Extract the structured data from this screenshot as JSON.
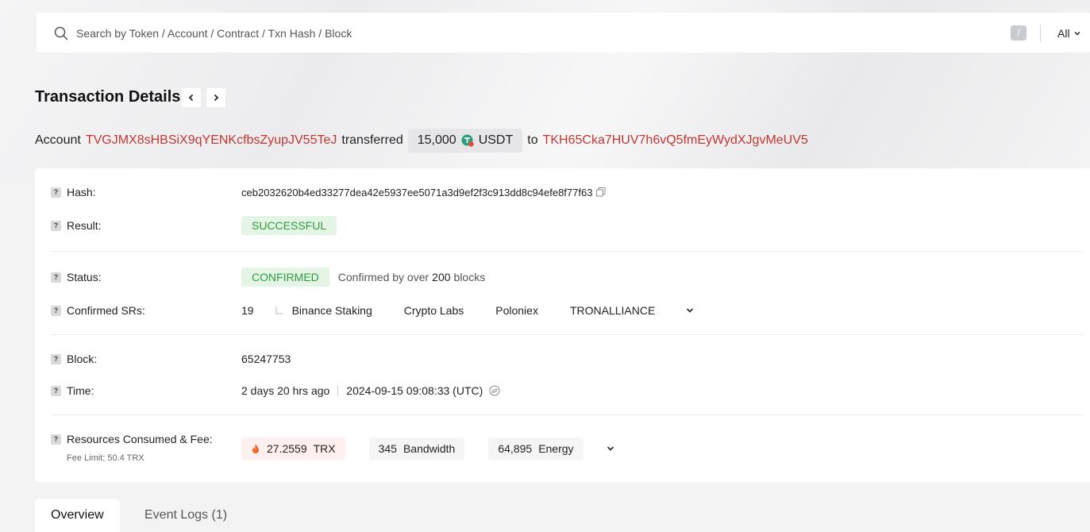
{
  "search": {
    "placeholder": "Search by Token / Account / Contract / Txn Hash / Block",
    "shortcut_key": "/",
    "scope": "All"
  },
  "page": {
    "title": "Transaction Details"
  },
  "summary": {
    "prefix": "Account",
    "from_address": "TVGJMX8sHBSiX9qYENKcfbsZyupJV55TeJ",
    "verb": "transferred",
    "amount": "15,000",
    "token": "USDT",
    "to_word": "to",
    "to_address": "TKH65Cka7HUV7h6vQ5fmEyWydXJgvMeUV5"
  },
  "details": {
    "hash": {
      "label": "Hash:",
      "value": "ceb2032620b4ed33277dea42e5937ee5071a3d9ef2f3c913dd8c94efe8f77f63"
    },
    "result": {
      "label": "Result:",
      "value": "SUCCESSFUL"
    },
    "status": {
      "label": "Status:",
      "value": "CONFIRMED",
      "note_prefix": "Confirmed by over",
      "note_count": "200",
      "note_suffix": "blocks"
    },
    "confirmed_srs": {
      "label": "Confirmed SRs:",
      "count": "19",
      "items": [
        "Binance Staking",
        "Crypto Labs",
        "Poloniex",
        "TRONALLIANCE"
      ]
    },
    "block": {
      "label": "Block:",
      "value": "65247753"
    },
    "time": {
      "label": "Time:",
      "relative": "2 days 20 hrs ago",
      "absolute": "2024-09-15 09:08:33 (UTC)"
    },
    "resources": {
      "label": "Resources Consumed & Fee:",
      "fee_limit": "Fee Limit: 50.4 TRX",
      "trx_amount": "27.2559",
      "trx_unit": "TRX",
      "bandwidth_amount": "345",
      "bandwidth_unit": "Bandwidth",
      "energy_amount": "64,895",
      "energy_unit": "Energy"
    }
  },
  "tabs": [
    {
      "label": "Overview",
      "active": true
    },
    {
      "label": "Event Logs (1)",
      "active": false
    }
  ],
  "colors": {
    "address_red": "#c23631",
    "success_green": "#2f9a3e",
    "success_bg": "#e4f5e5",
    "tether_green": "#26a17b"
  }
}
